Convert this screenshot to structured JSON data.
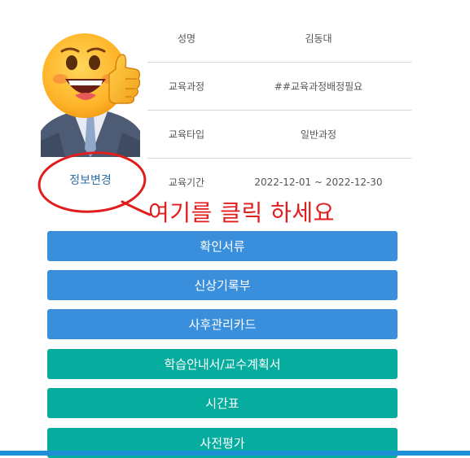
{
  "profile": {
    "fields": [
      {
        "label": "성명",
        "value": "김동대"
      },
      {
        "label": "교육과정",
        "value": "##교육과정배정필요"
      },
      {
        "label": "교육타입",
        "value": "일반과정"
      },
      {
        "label": "교육기간",
        "value": "2022-12-01 ~ 2022-12-30"
      }
    ],
    "edit_label": "정보변경"
  },
  "annotation": {
    "text": "여기를 클릭 하세요",
    "color": "#e11e1e"
  },
  "menu": {
    "buttons": [
      {
        "label": "확인서류",
        "color": "#3a8fdc"
      },
      {
        "label": "신상기록부",
        "color": "#3a8fdc"
      },
      {
        "label": "사후관리카드",
        "color": "#3a8fdc"
      },
      {
        "label": "학습안내서/교수계획서",
        "color": "#06ad9f"
      },
      {
        "label": "시간표",
        "color": "#06ad9f"
      },
      {
        "label": "사전평가",
        "color": "#06ad9f"
      }
    ]
  },
  "icons": {
    "emoji": "thumbs-up-emoji-icon"
  }
}
